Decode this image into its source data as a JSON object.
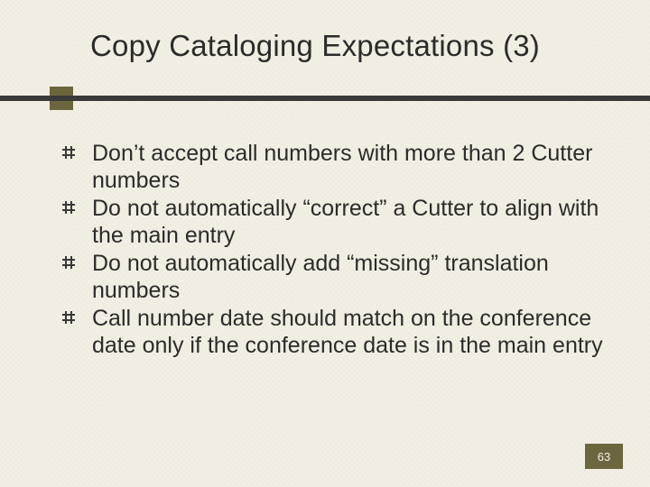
{
  "slide": {
    "title": "Copy Cataloging Expectations (3)",
    "bullets": [
      "Don’t accept call numbers with more than 2 Cutter numbers",
      "Do not automatically “correct” a Cutter to align with the main entry",
      "Do not automatically add “missing” translation numbers",
      "Call number date should match on the conference date only if the conference date is in the main entry"
    ],
    "page_number": "63"
  }
}
